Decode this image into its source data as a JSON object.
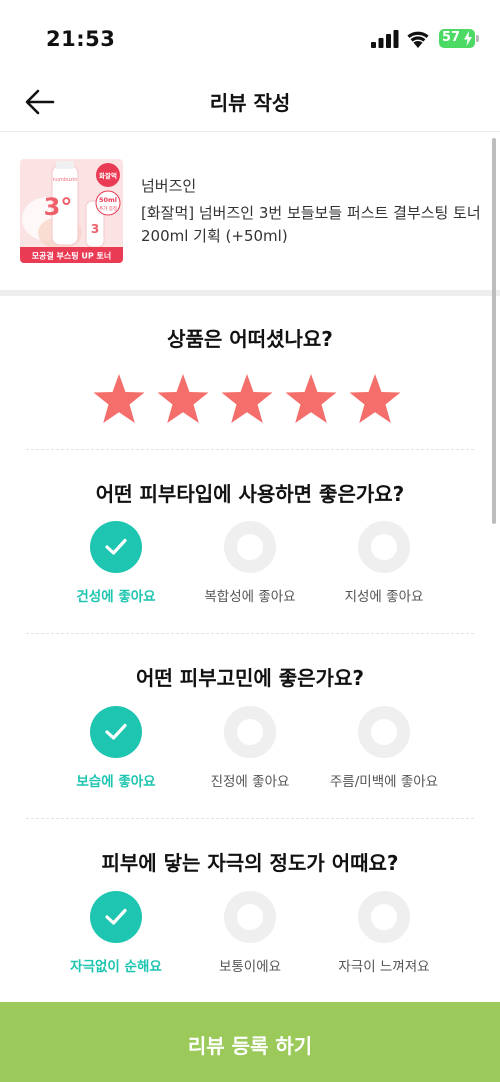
{
  "status_bar": {
    "time": "21:53",
    "battery_level": "57",
    "icons": [
      "signal-icon",
      "wifi-icon",
      "battery-icon"
    ]
  },
  "nav": {
    "title": "리뷰 작성",
    "back_icon": "arrow-left-icon"
  },
  "product": {
    "brand": "넘버즈인",
    "name": "[화잘먹] 넘버즈인 3번 보들보들 퍼스트 결부스팅 토너 200ml 기획 (+50ml)",
    "thumbnail": {
      "badge": "화잘먹",
      "sub_badge_line1": "50ml",
      "sub_badge_line2": "추가 증정",
      "bottom_text": "모공결 부스팅 UP 토너",
      "number": "3°",
      "bottle_brand": "numbuzin"
    }
  },
  "rating": {
    "question": "상품은 어떠셨나요?",
    "stars_total": 5,
    "stars_selected": 5,
    "star_color": "#f46e6b"
  },
  "questions": [
    {
      "title": "어떤 피부타입에 사용하면 좋은가요?",
      "options": [
        {
          "label": "건성에 좋아요",
          "selected": true
        },
        {
          "label": "복합성에 좋아요",
          "selected": false
        },
        {
          "label": "지성에 좋아요",
          "selected": false
        }
      ]
    },
    {
      "title": "어떤 피부고민에 좋은가요?",
      "options": [
        {
          "label": "보습에 좋아요",
          "selected": true
        },
        {
          "label": "진정에 좋아요",
          "selected": false
        },
        {
          "label": "주름/미백에 좋아요",
          "selected": false
        }
      ]
    },
    {
      "title": "피부에 닿는 자극의 정도가 어때요?",
      "options": [
        {
          "label": "자극없이 순해요",
          "selected": true
        },
        {
          "label": "보통이에요",
          "selected": false
        },
        {
          "label": "자극이 느껴져요",
          "selected": false
        }
      ]
    }
  ],
  "submit": {
    "label": "리뷰 등록 하기"
  },
  "colors": {
    "accent_teal": "#1ec5b0",
    "submit_green": "#9bc95a",
    "star": "#f46e6b",
    "unselected_ring": "#efefef"
  }
}
